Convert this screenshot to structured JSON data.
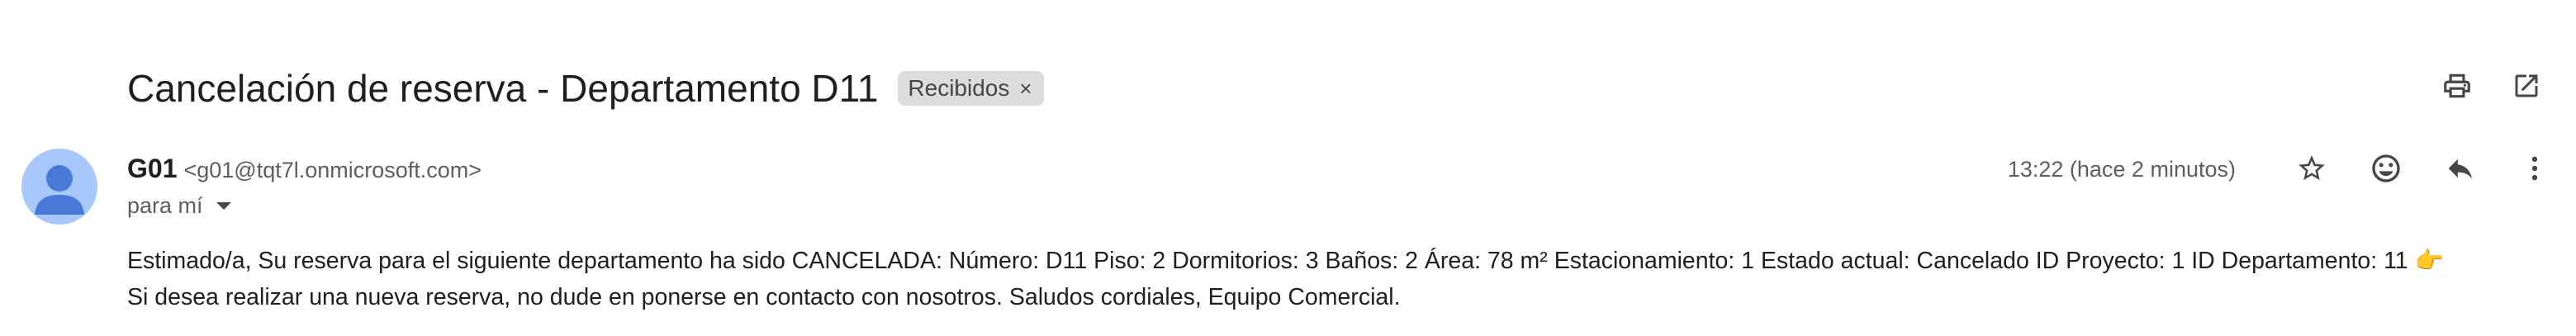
{
  "email": {
    "subject": "Cancelación de reserva - Departamento D11",
    "label_chip": "Recibidos",
    "label_chip_close": "×",
    "sender_name": "G01",
    "sender_email": "<g01@tqt7l.onmicrosoft.com>",
    "recipient_text": "para mí",
    "timestamp": "13:22 (hace 2 minutos)",
    "body_line1": "Estimado/a, Su reserva para el siguiente departamento ha sido CANCELADA: Número: D11 Piso: 2 Dormitorios: 3 Baños: 2 Área: 78 m² Estacionamiento: 1 Estado actual: Cancelado ID Proyecto: 1 ID Departamento: 11 👉",
    "body_line2": "Si desea realizar una nueva reserva, no dude en ponerse en contacto con nosotros. Saludos cordiales, Equipo Comercial."
  },
  "icons": {
    "print": "print-icon",
    "open_new_window": "open-in-new-window-icon",
    "star": "star-icon",
    "emoji": "emoji-reaction-icon",
    "reply": "reply-icon",
    "more": "more-vertical-icon",
    "avatar": "person-avatar-icon"
  },
  "colors": {
    "avatar_bg": "#a8c7fa",
    "avatar_fg": "#4a78d6",
    "chip_bg": "#dddddd",
    "icon": "#444746",
    "secondary_text": "#5e5e5e"
  }
}
